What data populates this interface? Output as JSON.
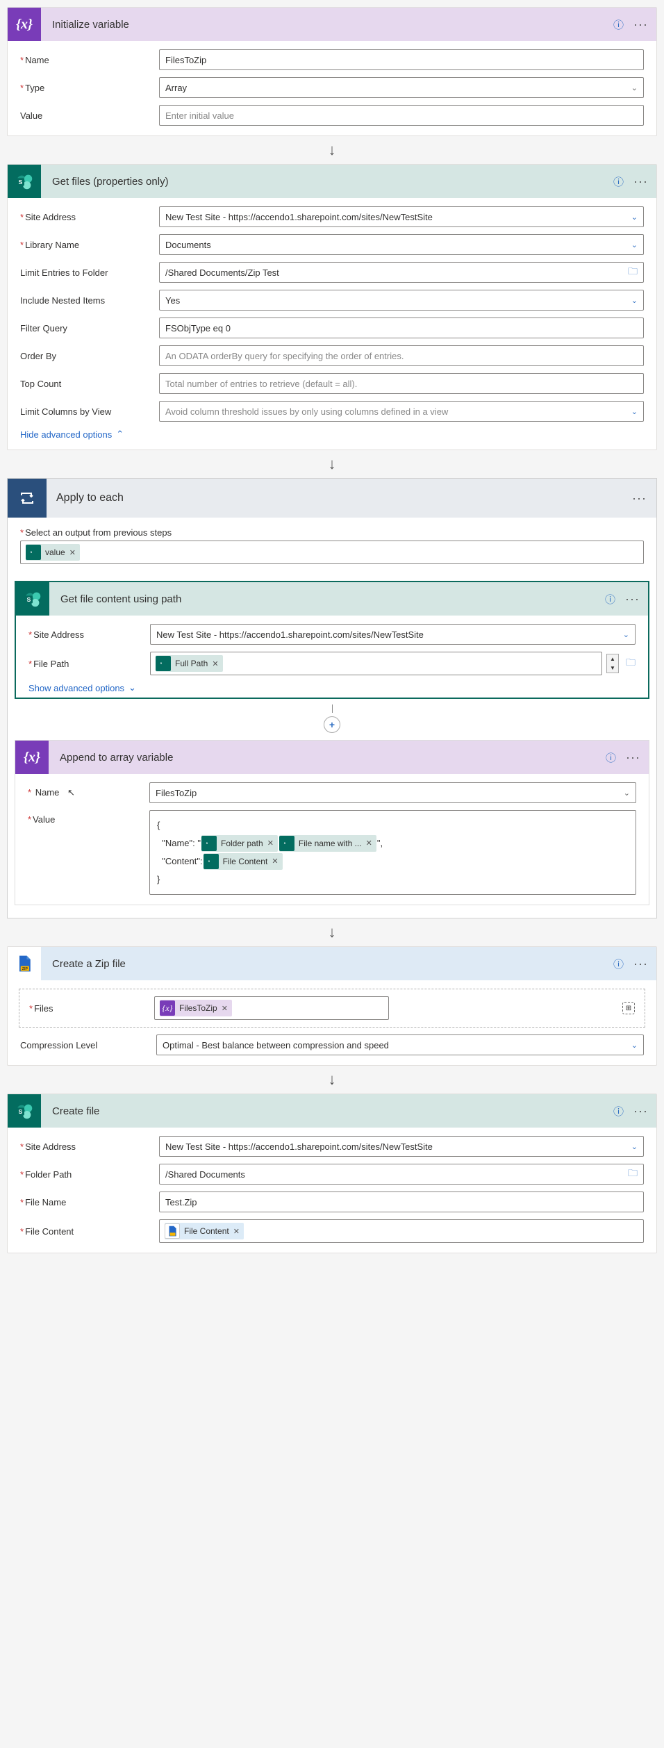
{
  "step1": {
    "title": "Initialize variable",
    "name_label": "Name",
    "name_value": "FilesToZip",
    "type_label": "Type",
    "type_value": "Array",
    "value_label": "Value",
    "value_placeholder": "Enter initial value"
  },
  "step2": {
    "title": "Get files (properties only)",
    "site_label": "Site Address",
    "site_value": "New Test Site - https://accendo1.sharepoint.com/sites/NewTestSite",
    "library_label": "Library Name",
    "library_value": "Documents",
    "limit_folder_label": "Limit Entries to Folder",
    "limit_folder_value": "/Shared Documents/Zip Test",
    "nested_label": "Include Nested Items",
    "nested_value": "Yes",
    "filter_label": "Filter Query",
    "filter_value": "FSObjType eq 0",
    "orderby_label": "Order By",
    "orderby_placeholder": "An ODATA orderBy query for specifying the order of entries.",
    "top_label": "Top Count",
    "top_placeholder": "Total number of entries to retrieve (default = all).",
    "limitcols_label": "Limit Columns by View",
    "limitcols_placeholder": "Avoid column threshold issues by only using columns defined in a view",
    "hide_advanced": "Hide advanced options"
  },
  "step3": {
    "title": "Apply to each",
    "select_label": "Select an output from previous steps",
    "token_value": "value",
    "inner1": {
      "title": "Get file content using path",
      "site_label": "Site Address",
      "site_value": "New Test Site - https://accendo1.sharepoint.com/sites/NewTestSite",
      "path_label": "File Path",
      "path_token": "Full Path",
      "show_advanced": "Show advanced options"
    },
    "inner2": {
      "title": "Append to array variable",
      "name_label": "Name",
      "name_value": "FilesToZip",
      "value_label": "Value",
      "code_open": "{",
      "code_name": "\"Name\": \"",
      "code_name_end": "\",",
      "code_content": "\"Content\":",
      "code_close": "}",
      "token_folder": "Folder path",
      "token_filename": "File name with ...",
      "token_filecontent": "File Content"
    }
  },
  "step4": {
    "title": "Create a Zip file",
    "files_label": "Files",
    "files_token": "FilesToZip",
    "compression_label": "Compression Level",
    "compression_value": "Optimal - Best balance between compression and speed"
  },
  "step5": {
    "title": "Create file",
    "site_label": "Site Address",
    "site_value": "New Test Site - https://accendo1.sharepoint.com/sites/NewTestSite",
    "folder_label": "Folder Path",
    "folder_value": "/Shared Documents",
    "filename_label": "File Name",
    "filename_value": "Test.Zip",
    "content_label": "File Content",
    "content_token": "File Content"
  }
}
